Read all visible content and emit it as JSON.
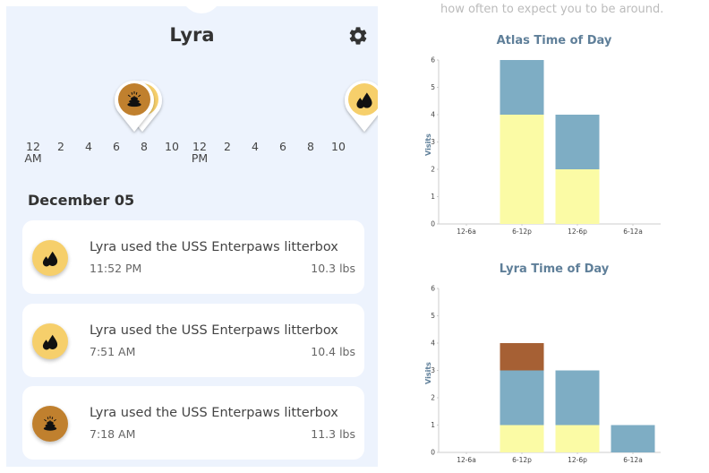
{
  "header": {
    "pet_name": "Lyra",
    "settings_icon": "gear-icon"
  },
  "timeline": {
    "ticks": [
      {
        "label": "12",
        "sub": "AM"
      },
      {
        "label": "2",
        "sub": ""
      },
      {
        "label": "4",
        "sub": ""
      },
      {
        "label": "6",
        "sub": ""
      },
      {
        "label": "8",
        "sub": ""
      },
      {
        "label": "10",
        "sub": ""
      },
      {
        "label": "12",
        "sub": "PM"
      },
      {
        "label": "2",
        "sub": ""
      },
      {
        "label": "4",
        "sub": ""
      },
      {
        "label": "6",
        "sub": ""
      },
      {
        "label": "8",
        "sub": ""
      },
      {
        "label": "10",
        "sub": ""
      }
    ],
    "pins": [
      {
        "type": "urine",
        "icon": "droplets-icon",
        "hour": 7.85,
        "color": "#f6cf6b"
      },
      {
        "type": "stool",
        "icon": "poop-icon",
        "hour": 7.3,
        "color": "#c0802e"
      },
      {
        "type": "urine",
        "icon": "droplets-icon",
        "hour": 23.87,
        "color": "#f6cf6b"
      }
    ]
  },
  "activity": {
    "date": "December 05",
    "events": [
      {
        "type": "urine",
        "icon": "droplets-icon",
        "color": "#f6cf6b",
        "message": "Lyra used the USS Enterpaws litterbox",
        "time": "11:52 PM",
        "weight": "10.3 lbs"
      },
      {
        "type": "urine",
        "icon": "droplets-icon",
        "color": "#f6cf6b",
        "message": "Lyra used the USS Enterpaws litterbox",
        "time": "7:51 AM",
        "weight": "10.4 lbs"
      },
      {
        "type": "stool",
        "icon": "poop-icon",
        "color": "#c0802e",
        "message": "Lyra used the USS Enterpaws litterbox",
        "time": "7:18 AM",
        "weight": "11.3 lbs"
      }
    ]
  },
  "intro_text": "how often to expect you to be around.",
  "chart_data": [
    {
      "type": "bar",
      "stacked": true,
      "title": "Atlas Time of Day",
      "xlabel": "",
      "ylabel": "Visits",
      "categories": [
        "12-6a",
        "6-12p",
        "12-6p",
        "6-12a"
      ],
      "ylim": [
        0,
        6
      ],
      "yticks": [
        0,
        1,
        2,
        3,
        4,
        5,
        6
      ],
      "grid": false,
      "series": [
        {
          "name": "yellow",
          "color": "#fbfba5",
          "values": [
            0,
            4,
            2,
            0
          ]
        },
        {
          "name": "blue",
          "color": "#7eadc4",
          "values": [
            0,
            2,
            2,
            0
          ]
        },
        {
          "name": "brown",
          "color": "#a66034",
          "values": [
            0,
            0,
            0,
            0
          ]
        }
      ]
    },
    {
      "type": "bar",
      "stacked": true,
      "title": "Lyra Time of Day",
      "xlabel": "",
      "ylabel": "Visits",
      "categories": [
        "12-6a",
        "6-12p",
        "12-6p",
        "6-12a"
      ],
      "ylim": [
        0,
        6
      ],
      "yticks": [
        0,
        1,
        2,
        3,
        4,
        5,
        6
      ],
      "grid": false,
      "series": [
        {
          "name": "yellow",
          "color": "#fbfba5",
          "values": [
            0,
            1,
            1,
            0
          ]
        },
        {
          "name": "blue",
          "color": "#7eadc4",
          "values": [
            0,
            2,
            2,
            1
          ]
        },
        {
          "name": "brown",
          "color": "#a66034",
          "values": [
            0,
            1,
            0,
            0
          ]
        }
      ]
    }
  ]
}
